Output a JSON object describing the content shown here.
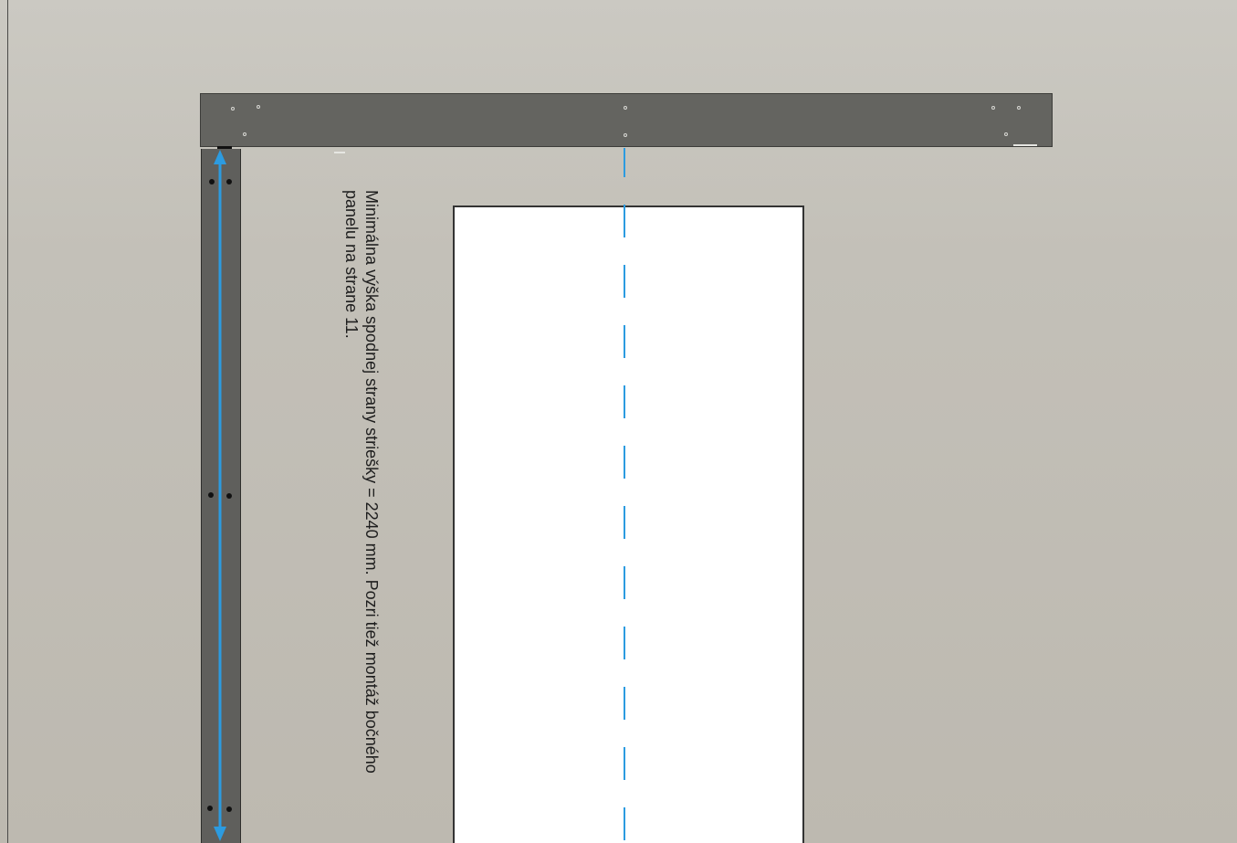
{
  "diagram": {
    "note": {
      "line1": "Minimálna výška spodnej strany striešky = 2240 mm. Pozri tiež montáž bočného",
      "line2": "panelu na strane 11."
    },
    "colors": {
      "background": "#c3c0b8",
      "profile": "#646460",
      "door_opening": "#ffffff",
      "dimension_arrow": "#2c9be0",
      "center_line": "#2c9be0"
    },
    "elements": {
      "top_profile": "horizontal-aluminium-profile",
      "side_profile": "vertical-side-profile",
      "dimension": "vertical-dimension-arrow",
      "center_line": "dashed-center-line"
    }
  }
}
